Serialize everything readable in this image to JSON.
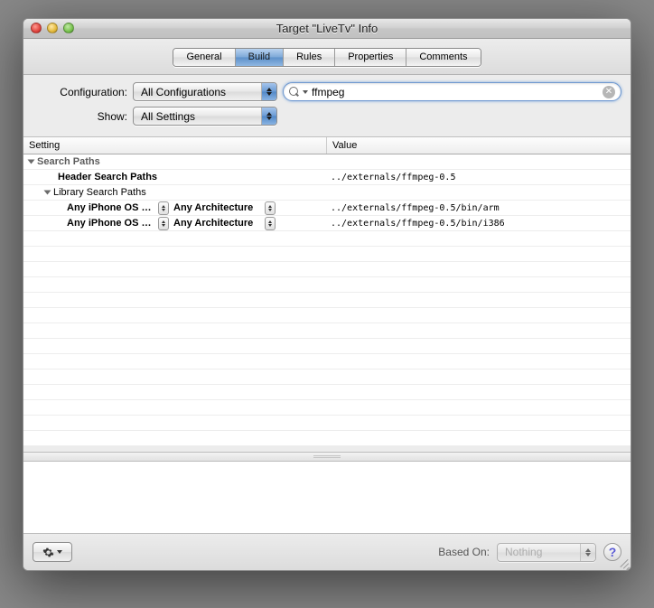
{
  "window": {
    "title": "Target \"LiveTv\" Info"
  },
  "tabs": {
    "general": "General",
    "build": "Build",
    "rules": "Rules",
    "properties": "Properties",
    "comments": "Comments",
    "selected": "build"
  },
  "config": {
    "configuration_label": "Configuration:",
    "configuration_value": "All Configurations",
    "show_label": "Show:",
    "show_value": "All Settings"
  },
  "search": {
    "value": "ffmpeg"
  },
  "columns": {
    "setting": "Setting",
    "value": "Value"
  },
  "rows": {
    "group1": "Search Paths",
    "hsp_label": "Header Search Paths",
    "hsp_value": "../externals/ffmpeg-0.5",
    "lsp_label": "Library Search Paths",
    "r1_sdk": "Any iPhone OS …",
    "r1_arch": "Any Architecture",
    "r1_val": "../externals/ffmpeg-0.5/bin/arm",
    "r2_sdk": "Any iPhone OS …",
    "r2_arch": "Any Architecture",
    "r2_val": "../externals/ffmpeg-0.5/bin/i386"
  },
  "footer": {
    "based_on_label": "Based On:",
    "based_on_value": "Nothing"
  }
}
